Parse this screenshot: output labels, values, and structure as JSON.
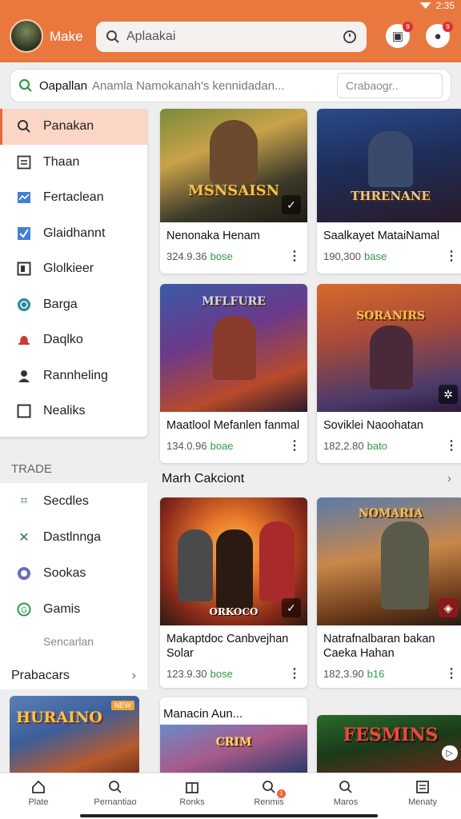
{
  "status": {
    "time": "2:35"
  },
  "header": {
    "app_name": "Make",
    "search_placeholder": "Aplaakai",
    "notifications_badge": "9",
    "profile_badge": "9"
  },
  "filter": {
    "label": "Oapallan",
    "text": "Anamla Namokanah's kennidadan...",
    "select_placeholder": "Crabaogr.."
  },
  "sidebar": {
    "items": [
      {
        "label": "Panakan",
        "icon": "search-icon"
      },
      {
        "label": "Thaan",
        "icon": "list-icon"
      },
      {
        "label": "Fertaclean",
        "icon": "image-icon"
      },
      {
        "label": "Glaidhannt",
        "icon": "checkbox-icon"
      },
      {
        "label": "Glolkieer",
        "icon": "square-icon"
      },
      {
        "label": "Barga",
        "icon": "globe-icon"
      },
      {
        "label": "Daqlko",
        "icon": "bell-icon"
      },
      {
        "label": "Rannheling",
        "icon": "person-icon"
      },
      {
        "label": "Nealiks",
        "icon": "box-icon"
      }
    ],
    "section_title": "TRADE",
    "section_items": [
      {
        "label": "Secdles",
        "icon": "grid-icon"
      },
      {
        "label": "Dastlnnga",
        "icon": "tools-icon"
      },
      {
        "label": "Sookas",
        "icon": "circle-icon"
      },
      {
        "label": "Gamis",
        "icon": "game-icon"
      }
    ],
    "sub_label": "Sencarlan",
    "more_label": "Prabacars",
    "promo_title": "HURAINO",
    "promo_tag": "NEW"
  },
  "cards": [
    {
      "art_title": "MSNSAISN",
      "name": "Nenonaka Henam",
      "price": "324.9.36",
      "currency": "bose"
    },
    {
      "art_title": "THRENANE",
      "name": "Saalkayet MataiNamal",
      "price": "190,300",
      "currency": "base"
    },
    {
      "art_title": "MFLFURE",
      "name": "Maatlool Mefanlen fanmal",
      "price": "134.0.96",
      "currency": "boae"
    },
    {
      "art_title": "SORANIRS",
      "name": "Soviklei Naoohatan",
      "price": "182,2.80",
      "currency": "bato"
    },
    {
      "art_title": "ORKOCO",
      "name": "Makaptdoc Canbvejhan Solar",
      "price": "123.9.30",
      "currency": "bose"
    },
    {
      "art_title": "NOMARIA",
      "name": "Natrafnalbaran bakan Caeka Hahan",
      "price": "182,3.90",
      "currency": "b16"
    },
    {
      "art_title": "CRIM",
      "name": "",
      "price": "",
      "currency": ""
    },
    {
      "art_title": "FESMINS",
      "name": "",
      "price": "",
      "currency": ""
    }
  ],
  "section": {
    "title": "Marh Cakciont"
  },
  "section2": {
    "title": "Manacin Aun..."
  },
  "bottom_nav": [
    {
      "label": "Plate"
    },
    {
      "label": "Pernantiao"
    },
    {
      "label": "Ronks"
    },
    {
      "label": "Renmis"
    },
    {
      "label": "Maros"
    },
    {
      "label": "Menaty"
    }
  ],
  "colors": {
    "accent": "#e9783f",
    "price_currency": "#2e9a4a",
    "active_bg": "#fbd5c6"
  }
}
